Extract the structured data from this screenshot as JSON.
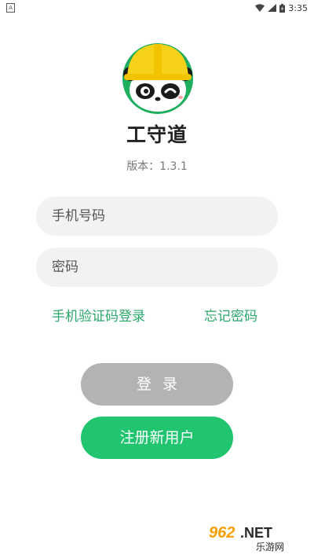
{
  "status_bar": {
    "time": "3:35",
    "left_icon_letter": "A"
  },
  "app": {
    "name": "工守道",
    "version": "版本：1.3.1"
  },
  "form": {
    "phone_placeholder": "手机号码",
    "password_placeholder": "密码"
  },
  "links": {
    "sms_login": "手机验证码登录",
    "forgot_password": "忘记密码"
  },
  "buttons": {
    "login": "登录",
    "register": "注册新用户"
  },
  "watermark": {
    "brand": "962.NET",
    "site": "乐游网"
  },
  "colors": {
    "accent_green": "#21c56f",
    "link_green": "#2aa86a",
    "disabled_gray": "#b3b3b3",
    "input_bg": "#f2f2f2"
  }
}
